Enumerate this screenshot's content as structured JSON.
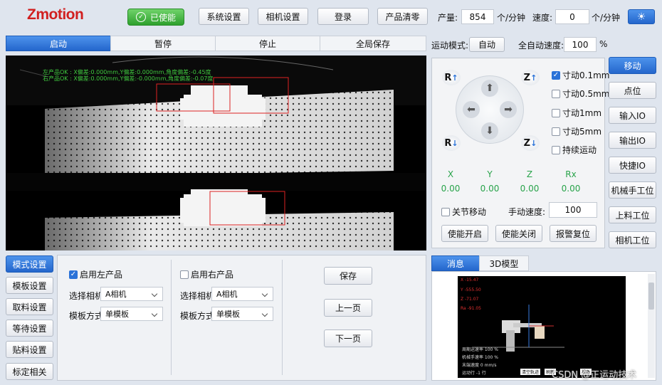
{
  "header": {
    "logo": "Zmotion",
    "enable_label": "已使能",
    "buttons": [
      "系统设置",
      "相机设置",
      "登录",
      "产品清零"
    ],
    "output_label": "产量:",
    "output_value": "854",
    "output_unit": "个/分钟",
    "speed_label": "速度:",
    "speed_value": "0",
    "speed_unit": "个/分钟"
  },
  "tabs": [
    "启动",
    "暂停",
    "停止",
    "全局保存"
  ],
  "camera": {
    "overlay_line1": "左产品OK : X偏差:0.000mm,Y偏差:0.000mm,角度偏差:-0.45度",
    "overlay_line2": "右产品OK : X偏差:0.000mm,Y偏差:-0.000mm,角度偏差:-0.07度"
  },
  "motion": {
    "mode_label": "运动模式:",
    "mode_value": "自动",
    "auto_speed_label": "全自动速度:",
    "auto_speed_value": "100",
    "auto_speed_unit": "%"
  },
  "jog": {
    "r_up": "R",
    "z_up": "Z",
    "r_down": "R",
    "z_down": "Z",
    "options": [
      {
        "label": "寸动0.1mm",
        "checked": true
      },
      {
        "label": "寸动0.5mm",
        "checked": false
      },
      {
        "label": "寸动1mm",
        "checked": false
      },
      {
        "label": "寸动5mm",
        "checked": false
      },
      {
        "label": "持续运动",
        "checked": false
      }
    ],
    "axes": [
      {
        "name": "X",
        "value": "0.00"
      },
      {
        "name": "Y",
        "value": "0.00"
      },
      {
        "name": "Z",
        "value": "0.00"
      },
      {
        "name": "Rx",
        "value": "0.00"
      }
    ],
    "joint_move_label": "关节移动",
    "manual_speed_label": "手动速度:",
    "manual_speed_value": "100",
    "buttons": [
      "使能开启",
      "使能关闭",
      "报警复位"
    ]
  },
  "right_nav": [
    "移动",
    "点位",
    "输入IO",
    "输出IO",
    "快捷IO",
    "机械手工位",
    "上料工位",
    "相机工位"
  ],
  "left_nav": [
    "模式设置",
    "模板设置",
    "取料设置",
    "等待设置",
    "贴料设置",
    "标定相关"
  ],
  "settings": {
    "left": {
      "enable_label": "启用左产品",
      "enabled": true,
      "camera_label": "选择相机",
      "camera_value": "A相机",
      "template_label": "模板方式",
      "template_value": "单模板"
    },
    "right": {
      "enable_label": "启用右产品",
      "enabled": false,
      "camera_label": "选择相机",
      "camera_value": "A相机",
      "template_label": "模板方式",
      "template_value": "单模板"
    },
    "buttons": [
      "保存",
      "上一页",
      "下一页"
    ]
  },
  "msg_tabs": [
    "消息",
    "3D模型"
  ],
  "model": {
    "coords": [
      "X  -15.47",
      "Y  -555.50",
      "Z  -71.07",
      "Ra  -91.05"
    ],
    "info": [
      "周期运速率  100   %",
      "机械手速率  100   %",
      "末端速度  0     mm/s",
      "运动行  -1      行"
    ],
    "btns": [
      "清空轨迹",
      "刷新",
      "视角"
    ]
  },
  "watermark": "CSDN @正运动技术"
}
